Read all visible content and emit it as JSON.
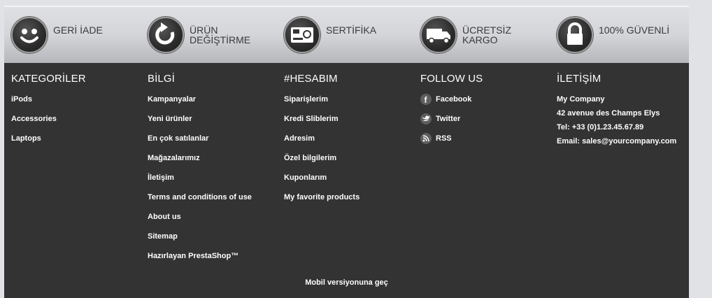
{
  "reassurance": [
    {
      "label": "GERİ İADE",
      "icon": "smiley-icon"
    },
    {
      "label": "ÜRÜN DEĞİŞTİRME",
      "icon": "refresh-icon"
    },
    {
      "label": "SERTİFİKA",
      "icon": "certificate-card-icon"
    },
    {
      "label": "ÜCRETSİZ KARGO",
      "icon": "truck-icon"
    },
    {
      "label": "100% GÜVENLİ",
      "icon": "lock-icon"
    }
  ],
  "footer": {
    "categories": {
      "title": "KATEGORİLER",
      "items": [
        "iPods",
        "Accessories",
        "Laptops"
      ]
    },
    "info": {
      "title": "BİLGİ",
      "items": [
        "Kampanyalar",
        "Yeni ürünler",
        "En çok satılanlar",
        "Mağazalarımız",
        "İletişim",
        "Terms and conditions of use",
        "About us",
        "Sitemap",
        "Hazırlayan PrestaShop™"
      ]
    },
    "account": {
      "title": "#HESABIM",
      "items": [
        "Siparişlerim",
        "Kredi Sliblerim",
        "Adresim",
        "Özel bilgilerim",
        "Kuponlarım",
        "My favorite products"
      ]
    },
    "follow": {
      "title": "FOLLOW US",
      "items": [
        {
          "label": "Facebook",
          "icon": "facebook-icon"
        },
        {
          "label": "Twitter",
          "icon": "twitter-icon"
        },
        {
          "label": "RSS",
          "icon": "rss-icon"
        }
      ]
    },
    "contact": {
      "title": "İLETİŞİM",
      "company": "My Company",
      "address": "42 avenue des Champs Elys",
      "phone": "Tel: +33 (0)1.23.45.67.89",
      "email": "Email: sales@yourcompany.com"
    },
    "mobile_link": "Mobil versiyonuna geç"
  },
  "colors": {
    "footer_bg": "#333333",
    "band_light": "#dfe0e4",
    "band_dark": "#b5b7ba",
    "page_bg": "#e1e2e6"
  }
}
